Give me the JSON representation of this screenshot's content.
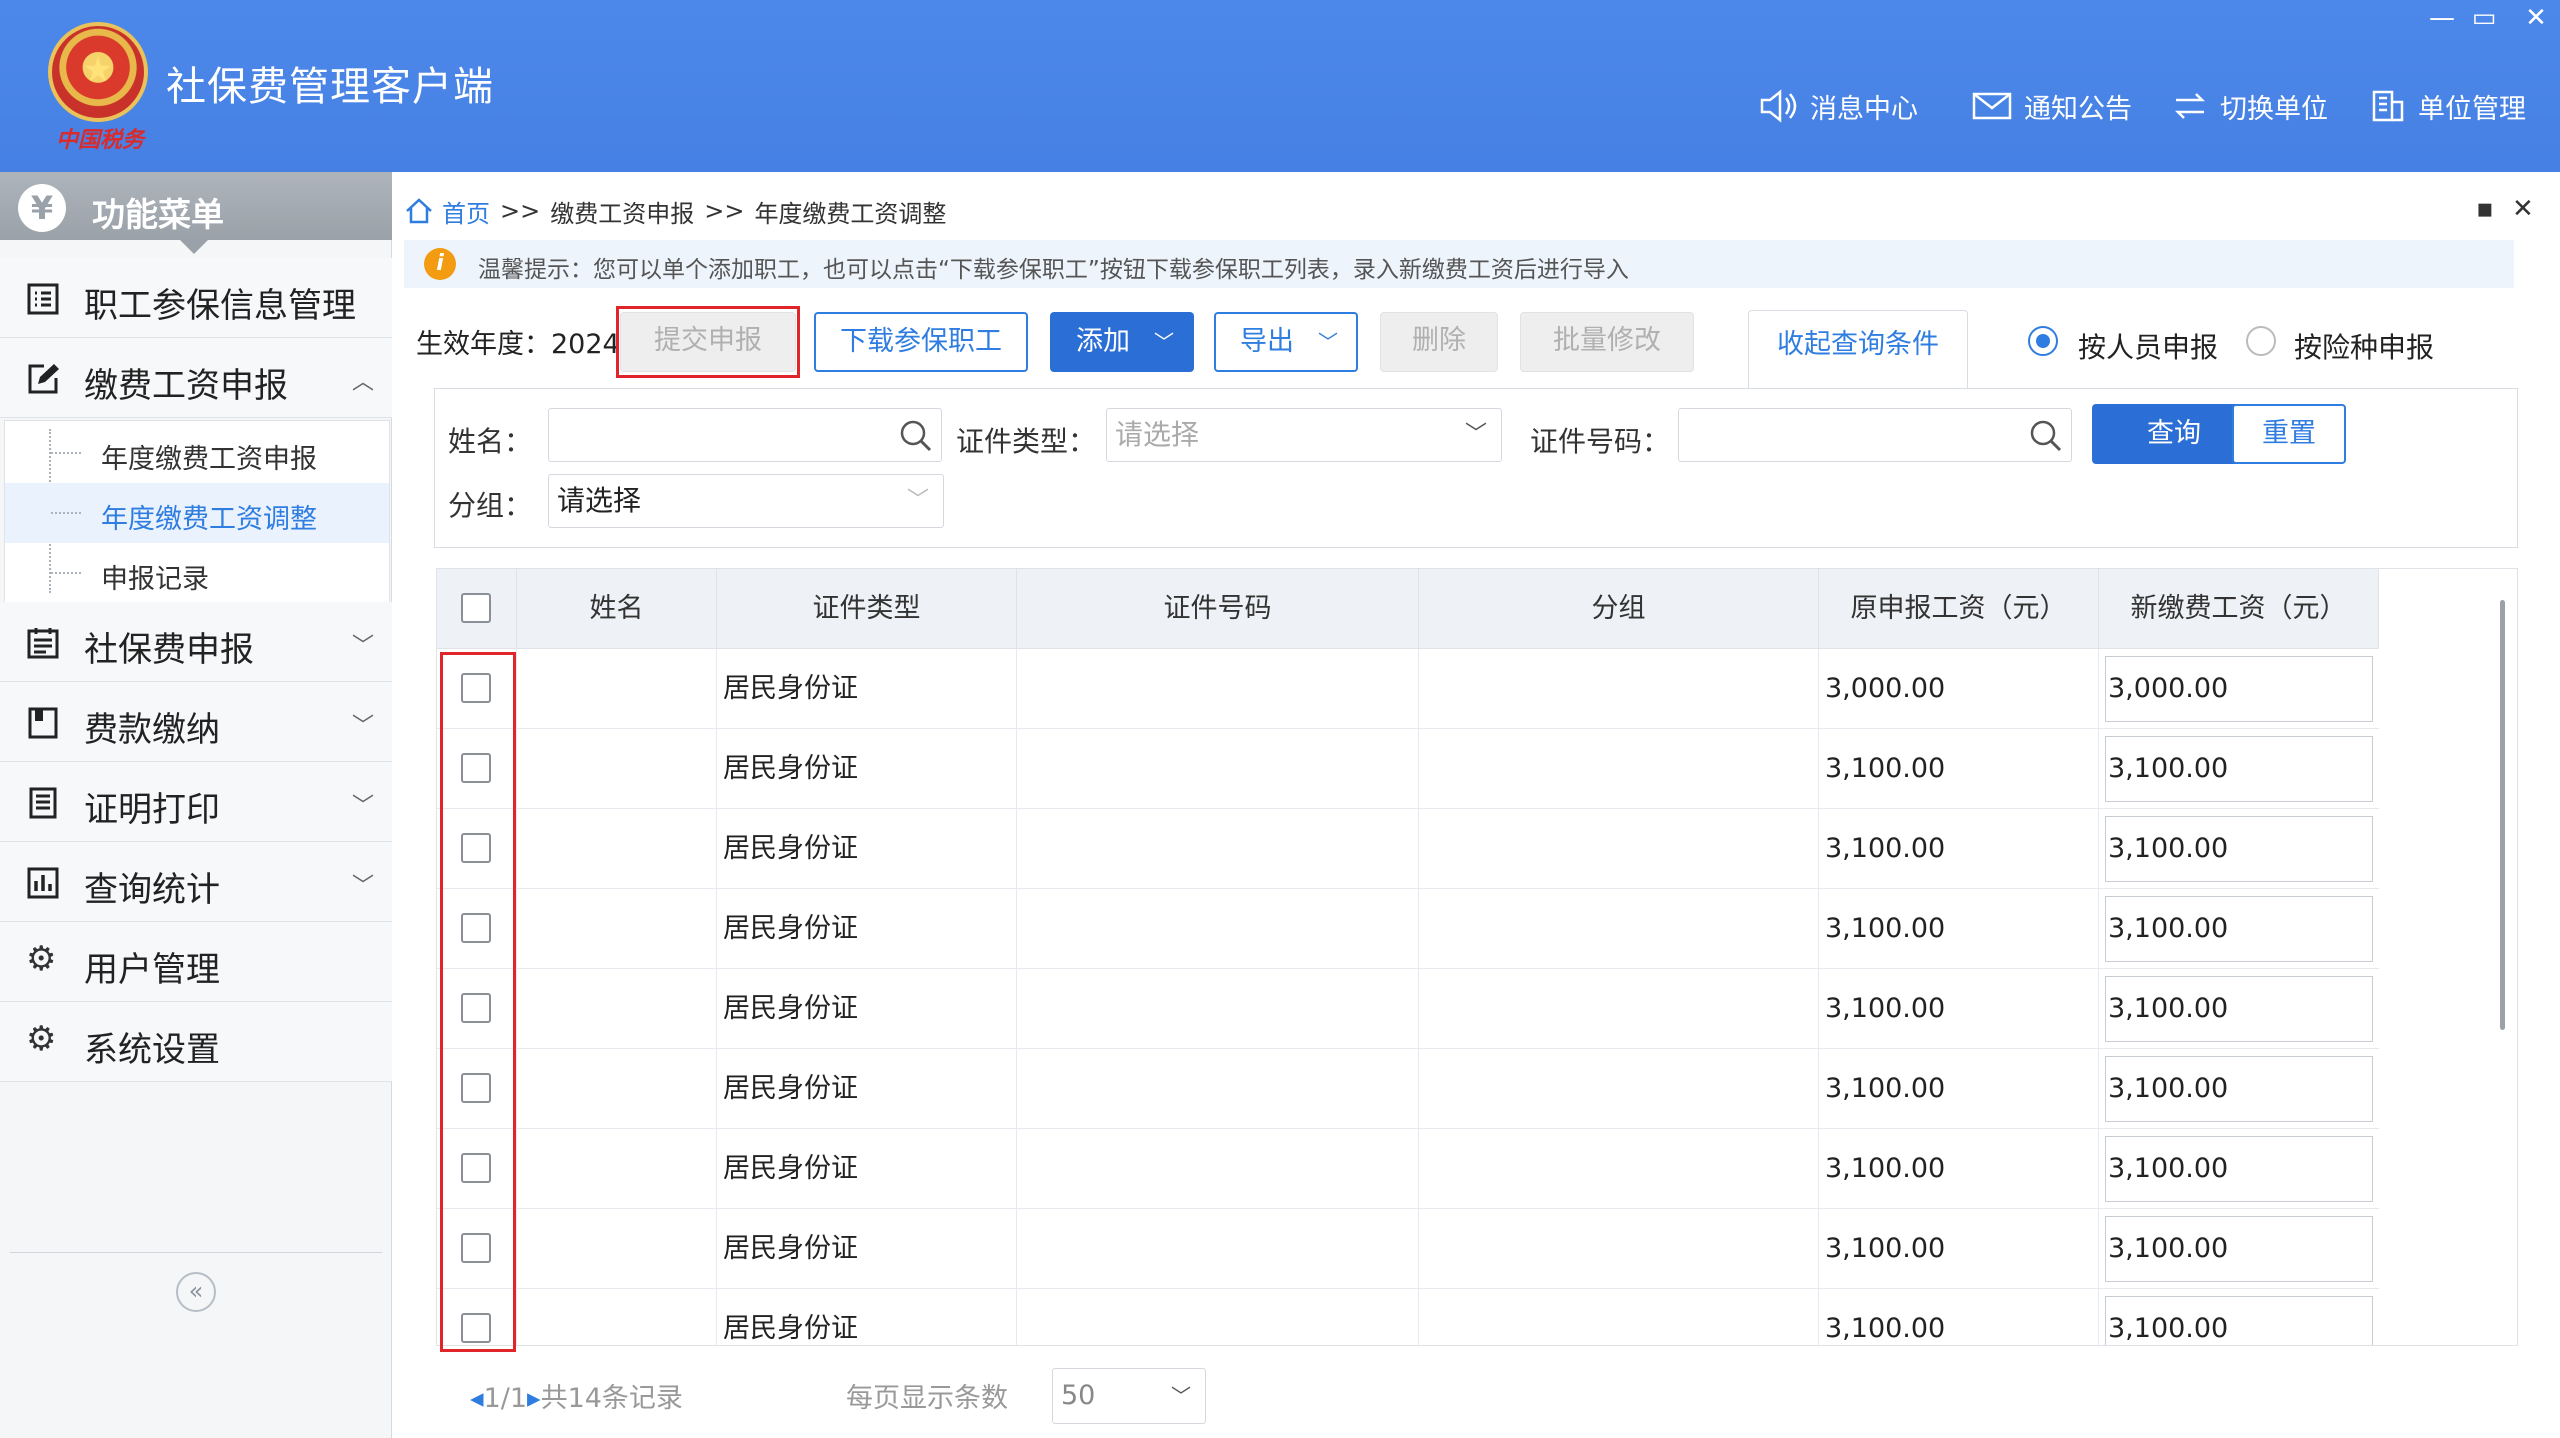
{
  "app": {
    "title": "社保费管理客户端",
    "emblem_caption": "中国税务"
  },
  "window_controls": {
    "minimize": "—",
    "restore": "▭",
    "close": "✕"
  },
  "topnav": [
    {
      "label": "消息中心",
      "icon": "speaker-icon"
    },
    {
      "label": "通知公告",
      "icon": "mail-icon"
    },
    {
      "label": "切换单位",
      "icon": "switch-icon"
    },
    {
      "label": "单位管理",
      "icon": "building-icon"
    }
  ],
  "sidebar": {
    "header": "功能菜单",
    "items": [
      {
        "label": "职工参保信息管理",
        "icon": "list-icon"
      },
      {
        "label": "缴费工资申报",
        "icon": "edit-icon",
        "expanded": true
      },
      {
        "label": "社保费申报",
        "icon": "calendar-icon"
      },
      {
        "label": "费款缴纳",
        "icon": "book-icon"
      },
      {
        "label": "证明打印",
        "icon": "doc-icon"
      },
      {
        "label": "查询统计",
        "icon": "chart-icon"
      },
      {
        "label": "用户管理",
        "icon": "gear-icon"
      },
      {
        "label": "系统设置",
        "icon": "gear-icon"
      }
    ],
    "subitems": [
      {
        "label": "年度缴费工资申报"
      },
      {
        "label": "年度缴费工资调整",
        "active": true
      },
      {
        "label": "申报记录"
      }
    ],
    "collapse": "«"
  },
  "breadcrumb": {
    "home": "首页",
    "sep": ">>",
    "level1": "缴费工资申报",
    "level2": "年度缴费工资调整"
  },
  "tip": "温馨提示：您可以单个添加职工，也可以点击“下载参保职工”按钮下载参保职工列表，录入新缴费工资后进行导入",
  "toolbar": {
    "year_label": "生效年度：2024",
    "submit": "提交申报",
    "download": "下载参保职工",
    "add": "添加",
    "export": "导出",
    "delete": "删除",
    "batch_edit": "批量修改",
    "collapse_query": "收起查询条件",
    "radio_person": "按人员申报",
    "radio_insurance": "按险种申报",
    "selected_mode": "按人员申报"
  },
  "query": {
    "name_label": "姓名：",
    "name_value": "",
    "idtype_label": "证件类型：",
    "idtype_placeholder": "请选择",
    "idno_label": "证件号码：",
    "idno_value": "",
    "group_label": "分组：",
    "group_value": "请选择",
    "search": "查询",
    "reset": "重置"
  },
  "table": {
    "columns": [
      "姓名",
      "证件类型",
      "证件号码",
      "分组",
      "原申报工资（元）",
      "新缴费工资（元）"
    ],
    "rows": [
      {
        "idtype": "居民身份证",
        "old": "3,000.00",
        "new": "3,000.00"
      },
      {
        "idtype": "居民身份证",
        "old": "3,100.00",
        "new": "3,100.00"
      },
      {
        "idtype": "居民身份证",
        "old": "3,100.00",
        "new": "3,100.00"
      },
      {
        "idtype": "居民身份证",
        "old": "3,100.00",
        "new": "3,100.00"
      },
      {
        "idtype": "居民身份证",
        "old": "3,100.00",
        "new": "3,100.00"
      },
      {
        "idtype": "居民身份证",
        "old": "3,100.00",
        "new": "3,100.00"
      },
      {
        "idtype": "居民身份证",
        "old": "3,100.00",
        "new": "3,100.00"
      },
      {
        "idtype": "居民身份证",
        "old": "3,100.00",
        "new": "3,100.00"
      },
      {
        "idtype": "居民身份证",
        "old": "3,100.00",
        "new": "3,100.00"
      }
    ]
  },
  "pager": {
    "page": "1/1",
    "total": "共14条记录",
    "per_page_label": "每页显示条数",
    "per_page": "50"
  },
  "colors": {
    "brand": "#4a86e8",
    "accent": "#2f7de0",
    "highlight": "#e0262b"
  }
}
